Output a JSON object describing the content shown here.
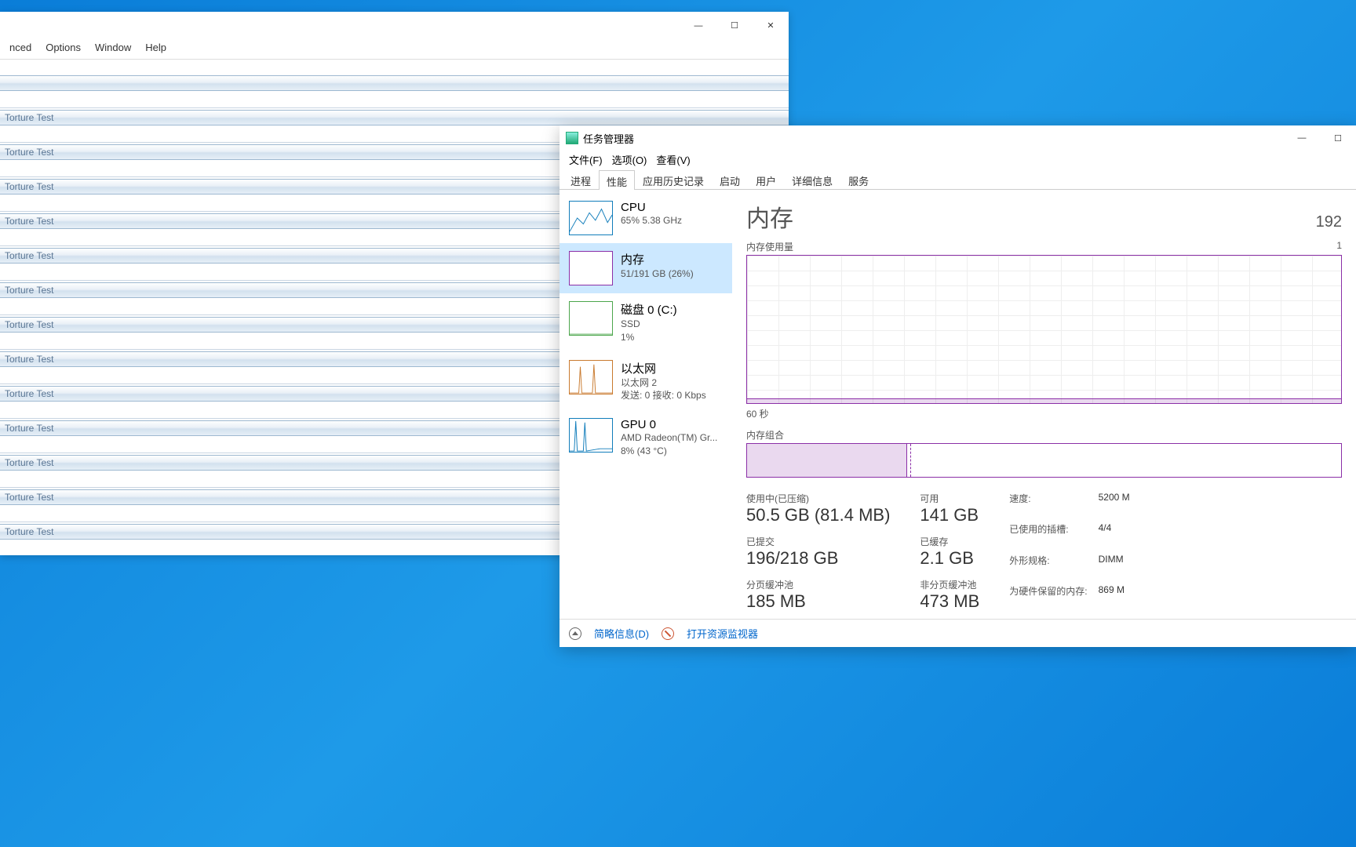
{
  "p95": {
    "menus": [
      "nced",
      "Options",
      "Window",
      "Help"
    ],
    "sub_title": "Torture Test",
    "sub_count": 13
  },
  "tm": {
    "title": "任务管理器",
    "menus": [
      "文件(F)",
      "选项(O)",
      "查看(V)"
    ],
    "tabs": [
      "进程",
      "性能",
      "应用历史记录",
      "启动",
      "用户",
      "详细信息",
      "服务"
    ],
    "side": {
      "cpu": {
        "name": "CPU",
        "sub": "65%  5.38 GHz"
      },
      "mem": {
        "name": "内存",
        "sub": "51/191 GB (26%)"
      },
      "disk": {
        "name": "磁盘 0 (C:)",
        "sub1": "SSD",
        "sub2": "1%"
      },
      "net": {
        "name": "以太网",
        "sub1": "以太网 2",
        "sub2": "发送: 0  接收: 0 Kbps"
      },
      "gpu": {
        "name": "GPU 0",
        "sub1": "AMD Radeon(TM) Gr...",
        "sub2": "8%  (43 °C)"
      }
    },
    "main": {
      "title": "内存",
      "capacity": "192",
      "usage_label": "内存使用量",
      "usage_max": "1",
      "xaxis": "60 秒",
      "comp_label": "内存组合",
      "stats": {
        "in_use_label": "使用中(已压缩)",
        "in_use": "50.5 GB (81.4 MB)",
        "avail_label": "可用",
        "avail": "141 GB",
        "committed_label": "已提交",
        "committed": "196/218 GB",
        "cached_label": "已缓存",
        "cached": "2.1 GB",
        "paged_label": "分页缓冲池",
        "paged": "185 MB",
        "nonpaged_label": "非分页缓冲池",
        "nonpaged": "473 MB"
      },
      "kv": {
        "speed_k": "速度:",
        "speed_v": "5200 M",
        "slots_k": "已使用的插槽:",
        "slots_v": "4/4",
        "form_k": "外形规格:",
        "form_v": "DIMM",
        "res_k": "为硬件保留的内存:",
        "res_v": "869 M"
      }
    },
    "foot": {
      "less": "简略信息(D)",
      "resmon": "打开资源监视器"
    }
  },
  "chart_data": {
    "type": "line",
    "title": "内存使用量",
    "xlabel": "60 秒",
    "ylabel": "",
    "x": [
      60,
      55,
      50,
      45,
      40,
      35,
      30,
      25,
      20,
      15,
      10,
      5,
      0
    ],
    "values": [
      3,
      3,
      3,
      3,
      3,
      3,
      3,
      3,
      3,
      3,
      3,
      3,
      3
    ],
    "ylim": [
      0,
      100
    ],
    "note": "values are approximate %-of-chart-height; flat near baseline"
  }
}
